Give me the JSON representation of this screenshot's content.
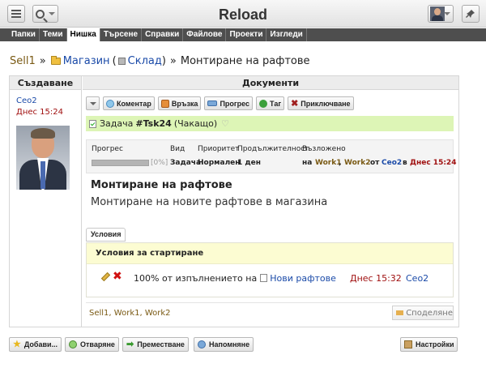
{
  "app": {
    "title": "Reload"
  },
  "nav": {
    "tabs": [
      "Папки",
      "Теми",
      "Нишка",
      "Търсене",
      "Справки",
      "Файлове",
      "Проекти",
      "Изгледи"
    ],
    "active_index": 2
  },
  "breadcrumb": {
    "root": "Sell1",
    "sep1": "»",
    "folder": "Магазин",
    "paren_open": "(",
    "sub": "Склад",
    "paren_close": ")",
    "sep2": "»",
    "current": "Монтиране на рафтове"
  },
  "columns": {
    "left": "Създаване",
    "right": "Документи"
  },
  "author": {
    "name": "Ceo2",
    "created": "Днес 15:24"
  },
  "toolbar": {
    "comment": "Коментар",
    "link": "Връзка",
    "progress": "Прогрес",
    "tag": "Таг",
    "close": "Приключване"
  },
  "task": {
    "prefix": "Задача",
    "id": "#Tsk24",
    "status": "(Чакащо)"
  },
  "info": {
    "headers": {
      "progress": "Прогрес",
      "kind": "Вид",
      "priority": "Приоритет",
      "duration": "Продължителност",
      "assigned": "Възложено"
    },
    "progress_percent": 0,
    "progress_text": "[0%]",
    "kind": "Задача",
    "priority": "Нормален",
    "duration": "1 ден",
    "assigned_prefix": "на",
    "assignee1": "Work1",
    "comma": ",",
    "assignee2": "Work2",
    "from_word": "от",
    "from_user": "Ceo2",
    "at_word": "в",
    "at_time": "Днес 15:24"
  },
  "body": {
    "title": "Монтиране на рафтове",
    "description": "Монтиране на новите рафтове в магазина"
  },
  "conditions": {
    "tab_label": "Условия",
    "heading": "Условия за стартиране",
    "row": {
      "text": "100% от изпълнението на",
      "link": "Нови рафтове",
      "date": "Днес 15:32",
      "user": "Ceo2"
    }
  },
  "footer": {
    "tags": [
      "Sell1",
      "Work1",
      "Work2"
    ],
    "share": "Споделяне"
  },
  "bottom": {
    "add": "Добави...",
    "open": "Отваряне",
    "move": "Преместване",
    "remind": "Напомняне",
    "settings": "Настройки"
  },
  "colors": {
    "accent_green": "#ddf5b6",
    "nav_bg": "#4e4e4e",
    "link_brown": "#7a5a14",
    "link_blue": "#1a4aa8",
    "date_red": "#a01010"
  }
}
